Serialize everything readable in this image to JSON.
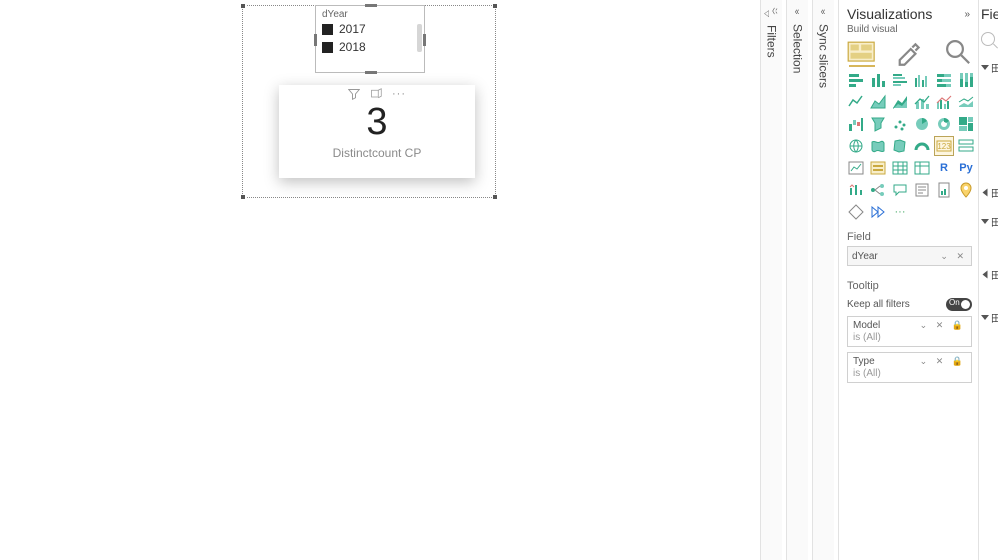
{
  "canvas": {
    "slicer": {
      "title": "dYear",
      "items": [
        {
          "label": "2017",
          "checked": true
        },
        {
          "label": "2018",
          "checked": true
        }
      ]
    },
    "card": {
      "value": "3",
      "label": "Distinctcount CP"
    }
  },
  "tabs": {
    "filters": "Filters",
    "selection": "Selection",
    "sync": "Sync slicers"
  },
  "vis": {
    "title": "Visualizations",
    "subhead": "Build visual",
    "field_section": "Field",
    "field_value": "dYear",
    "tooltip_section": "Tooltip",
    "keep_all": "Keep all filters",
    "toggle_label": "On",
    "items": [
      {
        "name": "Model",
        "sub": "is (All)"
      },
      {
        "name": "Type",
        "sub": "is (All)"
      }
    ],
    "r_label": "R",
    "py_label": "Py",
    "more": "···"
  },
  "fields": {
    "title": "Fie",
    "groups": [
      "",
      "",
      "",
      "",
      ""
    ]
  }
}
